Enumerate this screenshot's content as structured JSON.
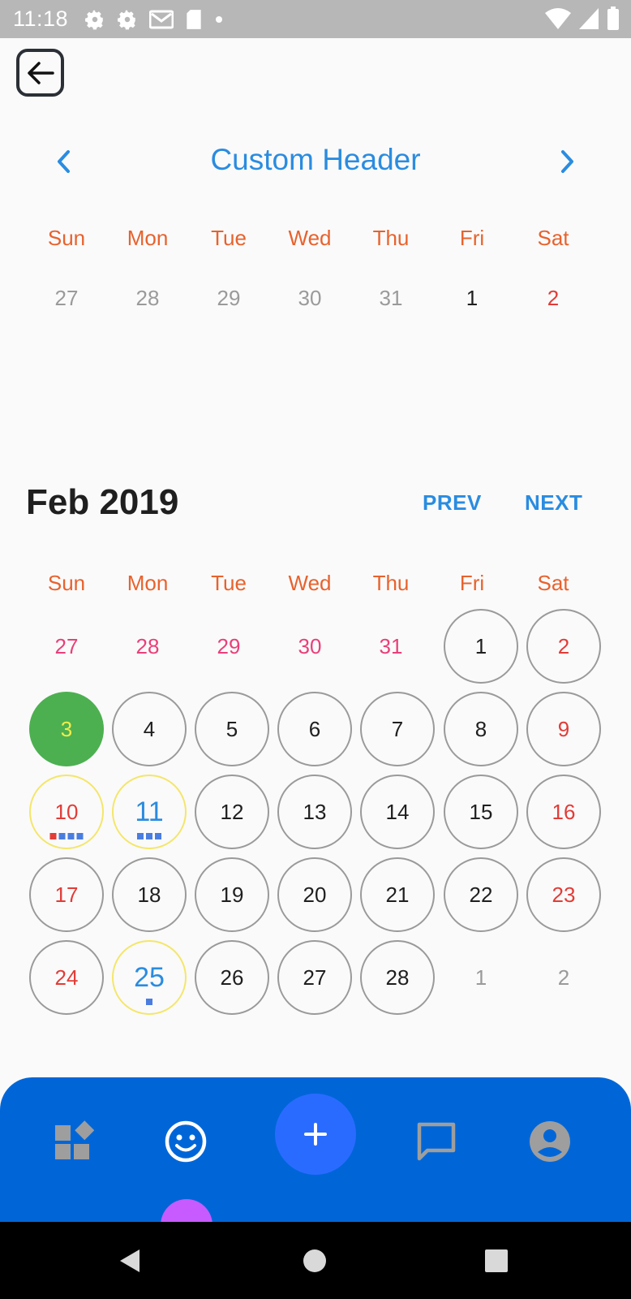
{
  "status_bar": {
    "time": "11:18",
    "icons": [
      "gear-icon",
      "gear-icon",
      "mail-icon",
      "sd-card-icon",
      "dot-icon",
      "wifi-icon",
      "signal-icon",
      "battery-icon"
    ]
  },
  "back_button": {
    "icon": "arrow-left-icon"
  },
  "custom_calendar": {
    "header": "Custom Header",
    "weekdays": [
      "Sun",
      "Mon",
      "Tue",
      "Wed",
      "Thu",
      "Fri",
      "Sat"
    ],
    "days": [
      "27",
      "28",
      "29",
      "30",
      "31",
      "1",
      "2"
    ]
  },
  "month_calendar": {
    "title": "Feb 2019",
    "prev_label": "PREV",
    "next_label": "NEXT",
    "weekdays": [
      "Sun",
      "Mon",
      "Tue",
      "Wed",
      "Thu",
      "Fri",
      "Sat"
    ],
    "weeks": [
      [
        "27",
        "28",
        "29",
        "30",
        "31",
        "1",
        "2"
      ],
      [
        "3",
        "4",
        "5",
        "6",
        "7",
        "8",
        "9"
      ],
      [
        "10",
        "11",
        "12",
        "13",
        "14",
        "15",
        "16"
      ],
      [
        "17",
        "18",
        "19",
        "20",
        "21",
        "22",
        "23"
      ],
      [
        "24",
        "25",
        "26",
        "27",
        "28",
        "1",
        "2"
      ]
    ]
  },
  "bottom_nav": {
    "items": [
      "dashboard-icon",
      "smiley-icon",
      "add-icon",
      "chat-icon",
      "account-icon"
    ]
  },
  "colors": {
    "accent": "#2a8ce0",
    "weekday": "#e8622d",
    "today": "#4cb050",
    "nav_bg": "#0066d8",
    "fab": "#2a6bff",
    "indicator": "#c75bff"
  }
}
